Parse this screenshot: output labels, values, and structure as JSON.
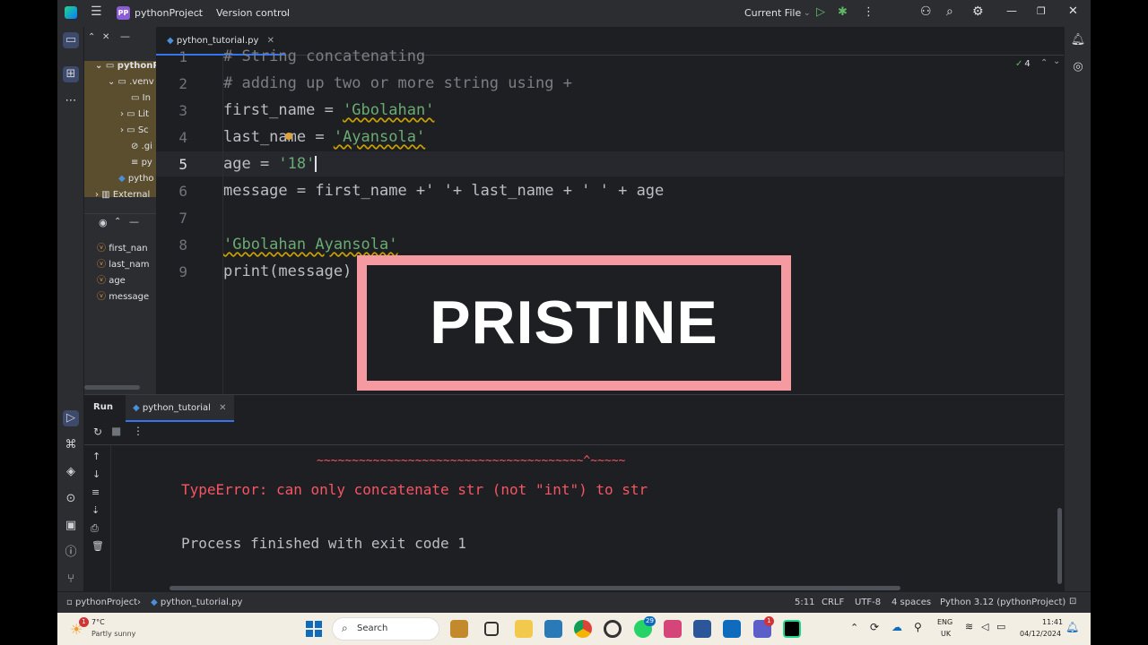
{
  "titlebar": {
    "project_badge": "PP",
    "project_name": "pythonProject",
    "vcs": "Version control",
    "run_config": "Current File"
  },
  "project_tree": {
    "items": [
      {
        "label": "pythonP"
      },
      {
        "label": ".venv"
      },
      {
        "label": "In"
      },
      {
        "label": "Lit"
      },
      {
        "label": "Sc"
      },
      {
        "label": ".gi"
      },
      {
        "label": "py"
      },
      {
        "label": "pytho"
      },
      {
        "label": "External"
      }
    ]
  },
  "structure": {
    "items": [
      {
        "label": "first_nan"
      },
      {
        "label": "last_nam"
      },
      {
        "label": "age"
      },
      {
        "label": "message"
      }
    ]
  },
  "editor": {
    "tab_label": "python_tutorial.py",
    "inspection_count": "4",
    "lines": [
      {
        "n": "1",
        "text": "# String concatenating"
      },
      {
        "n": "2",
        "text": "# adding up two or more string using +"
      },
      {
        "n": "3",
        "a": "first_name = ",
        "s": "'Gbolahan'"
      },
      {
        "n": "4",
        "a": "last_name = ",
        "s": "'Ayansola'"
      },
      {
        "n": "5",
        "a": "age = ",
        "s": "'18'"
      },
      {
        "n": "6",
        "text": "message = first_name +' '+ last_name + ' ' + age"
      },
      {
        "n": "7",
        "text": ""
      },
      {
        "n": "8",
        "s": "'Gbolahan Ayansola'"
      },
      {
        "n": "9",
        "text": "print(message)"
      }
    ]
  },
  "overlay": {
    "text": "PRISTINE"
  },
  "run": {
    "label": "Run",
    "tab_label": "python_tutorial",
    "output": {
      "carets": "~~~~~~~~~~~~~~~~~~~~~~~~~~~~~~~~~~~~~~^~~~~~",
      "error": "TypeError: can only concatenate str (not \"int\") to str",
      "exit": "Process finished with exit code 1"
    }
  },
  "statusbar": {
    "project": "pythonProject",
    "file": "python_tutorial.py",
    "position": "5:11",
    "line_sep": "CRLF",
    "encoding": "UTF-8",
    "indent": "4 spaces",
    "interpreter": "Python 3.12 (pythonProject)"
  },
  "taskbar": {
    "temperature": "7°C",
    "weather": "Partly sunny",
    "weather_badge": "1",
    "search_placeholder": "Search",
    "whatsapp_badge": "29",
    "teams_badge": "1",
    "lang_1": "ENG",
    "lang_2": "UK",
    "time": "11:41",
    "date": "04/12/2024"
  },
  "colors": {
    "accent": "#3574f0",
    "string": "#6aab73",
    "error": "#f75464",
    "overlay_border": "#f49aa0"
  }
}
